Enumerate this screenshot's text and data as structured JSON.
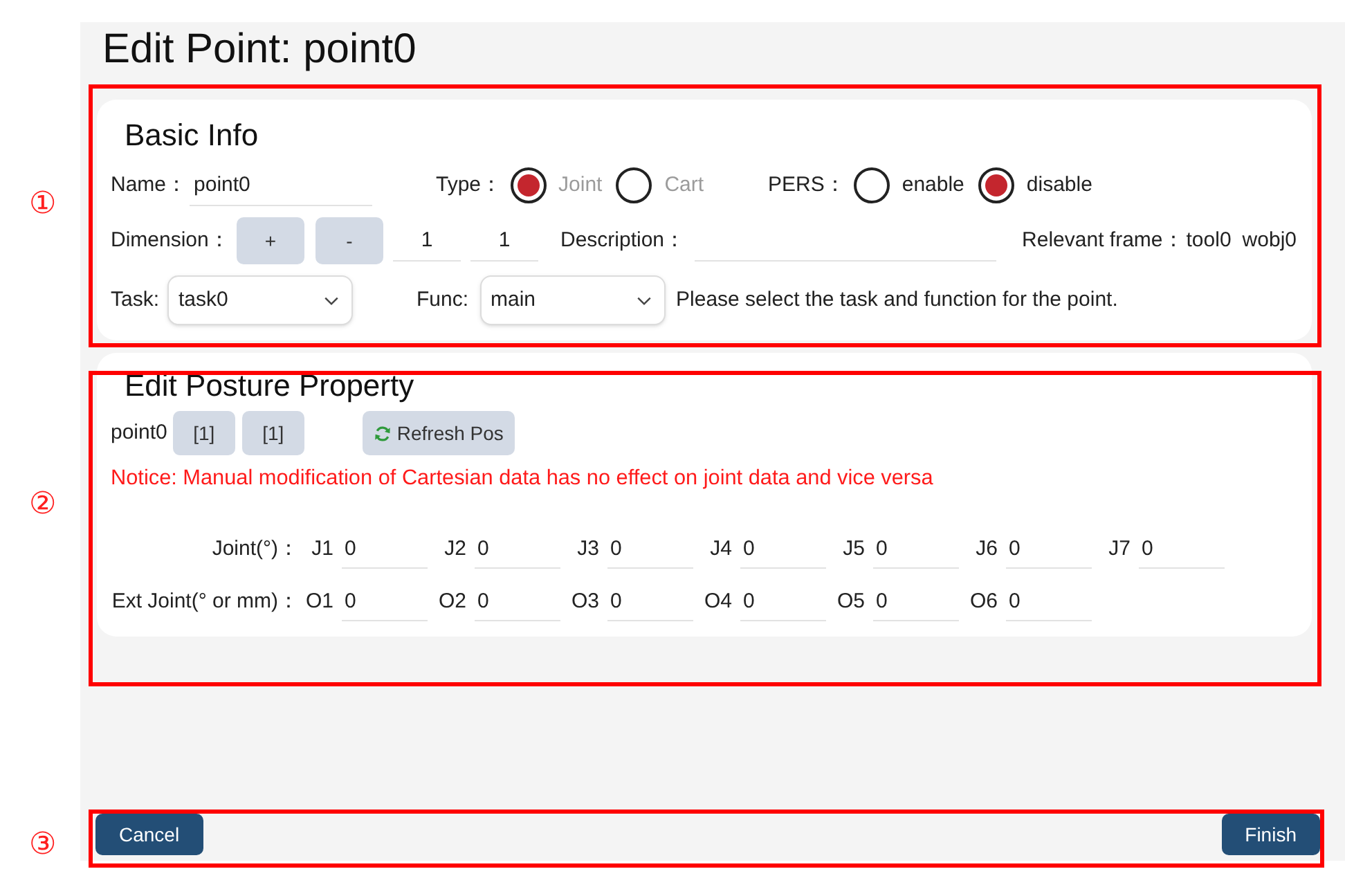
{
  "title": "Edit Point: point0",
  "basic_info": {
    "heading": "Basic Info",
    "name": {
      "label": "Name：",
      "value": "point0"
    },
    "type": {
      "label": "Type：",
      "options": [
        {
          "label": "Joint",
          "selected": true,
          "disabled": true
        },
        {
          "label": "Cart",
          "selected": false,
          "disabled": true
        }
      ]
    },
    "pers": {
      "label": "PERS：",
      "options": [
        {
          "label": "enable",
          "selected": false,
          "disabled": false
        },
        {
          "label": "disable",
          "selected": true,
          "disabled": false
        }
      ]
    },
    "dimension": {
      "label": "Dimension：",
      "buttons": [
        "+",
        "-"
      ],
      "values": [
        "1",
        "1"
      ]
    },
    "description": {
      "label": "Description："
    },
    "relevant_frame": {
      "label": "Relevant frame：",
      "values": [
        "tool0",
        "wobj0"
      ]
    },
    "task": {
      "label": "Task:",
      "value": "task0"
    },
    "func": {
      "label": "Func:",
      "value": "main"
    },
    "hint": "Please select the task and function for the point."
  },
  "posture": {
    "heading": "Edit Posture Property",
    "point_name": "point0",
    "index_buttons": [
      "[1]",
      "[1]"
    ],
    "refresh_button": "Refresh Pos",
    "notice": "Notice: Manual modification of Cartesian data has no effect on joint data and vice versa",
    "rows": [
      {
        "label": "Joint(°)：",
        "fields": [
          {
            "label": "J1",
            "value": "0"
          },
          {
            "label": "J2",
            "value": "0"
          },
          {
            "label": "J3",
            "value": "0"
          },
          {
            "label": "J4",
            "value": "0"
          },
          {
            "label": "J5",
            "value": "0"
          },
          {
            "label": "J6",
            "value": "0"
          },
          {
            "label": "J7",
            "value": "0"
          }
        ]
      },
      {
        "label": "Ext Joint(° or mm)：",
        "fields": [
          {
            "label": "O1",
            "value": "0"
          },
          {
            "label": "O2",
            "value": "0"
          },
          {
            "label": "O3",
            "value": "0"
          },
          {
            "label": "O4",
            "value": "0"
          },
          {
            "label": "O5",
            "value": "0"
          },
          {
            "label": "O6",
            "value": "0"
          }
        ]
      }
    ]
  },
  "footer": {
    "buttons": [
      {
        "label": "Cancel"
      },
      {
        "label": "Finish"
      }
    ]
  },
  "annotations": [
    {
      "label": "①"
    },
    {
      "label": "②"
    },
    {
      "label": "③"
    }
  ]
}
